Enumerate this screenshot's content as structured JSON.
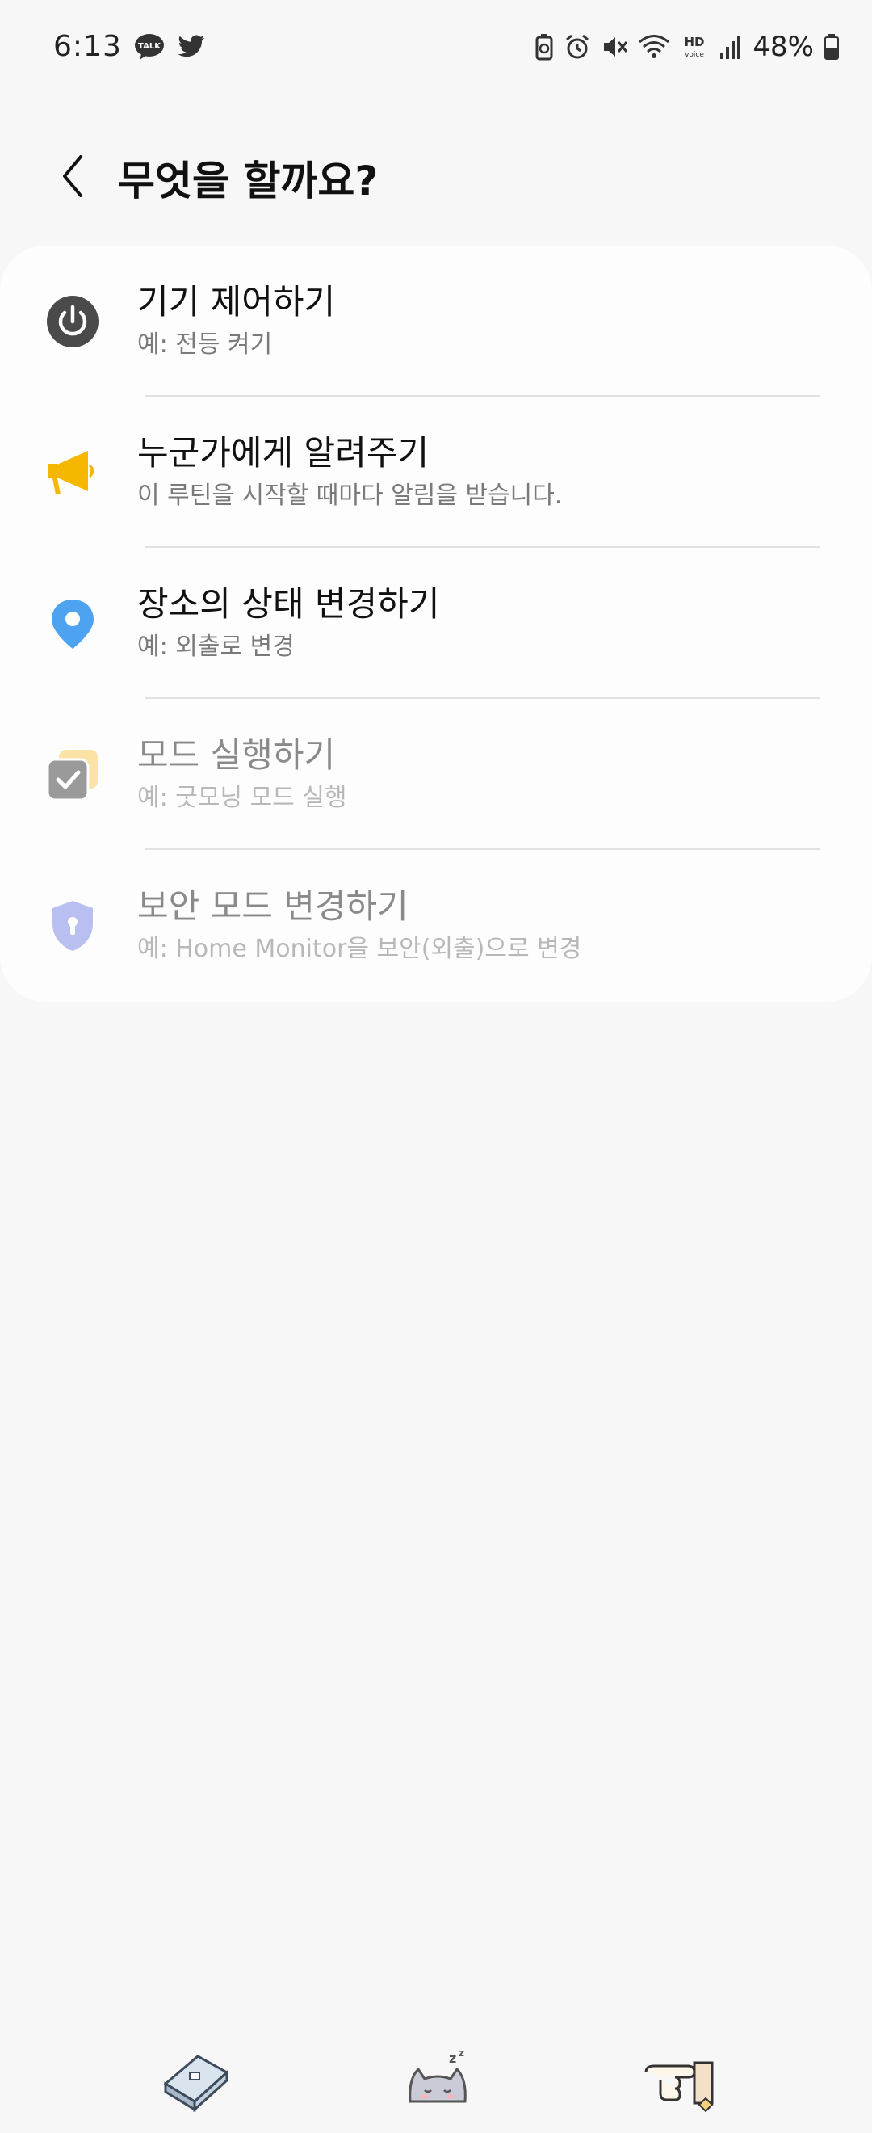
{
  "status_bar": {
    "time": "6:13",
    "battery_percent": "48%",
    "left_icons": [
      "talk-icon",
      "twitter-icon"
    ],
    "right_icons": [
      "battery-saver-icon",
      "alarm-icon",
      "mute-icon",
      "wifi-icon",
      "hd-voice-icon",
      "signal-icon",
      "battery-icon"
    ]
  },
  "header": {
    "title": "무엇을 할까요?",
    "back_icon": "back-icon"
  },
  "actions": [
    {
      "title": "기기 제어하기",
      "subtitle": "예: 전등 켜기",
      "icon": "power-icon",
      "icon_color": "#4a4a4a",
      "enabled": true
    },
    {
      "title": "누군가에게 알려주기",
      "subtitle": "이 루틴을 시작할 때마다 알림을 받습니다.",
      "icon": "megaphone-icon",
      "icon_color": "#f5b700",
      "enabled": true
    },
    {
      "title": "장소의 상태 변경하기",
      "subtitle": "예: 외출로 변경",
      "icon": "location-pin-icon",
      "icon_color": "#4da3f0",
      "enabled": true
    },
    {
      "title": "모드 실행하기",
      "subtitle": "예: 굿모닝 모드 실행",
      "icon": "mode-check-icon",
      "icon_color": "#9a9a9a",
      "enabled": false
    },
    {
      "title": "보안 모드 변경하기",
      "subtitle": "예: Home Monitor을 보안(외출)으로 변경",
      "icon": "shield-lock-icon",
      "icon_color": "#b9bff0",
      "enabled": false
    }
  ],
  "bottom_nav": {
    "items": [
      "book-icon",
      "sleeping-cat-icon",
      "pointing-hand-icon"
    ]
  }
}
